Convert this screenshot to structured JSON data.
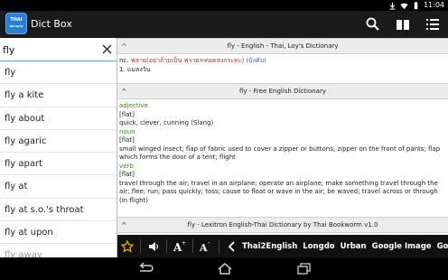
{
  "status_bar": {
    "time": "11:04",
    "icons": [
      "download-icon",
      "wifi-icon",
      "battery-icon"
    ]
  },
  "action_bar": {
    "app_icon_text_1": "THAI",
    "app_icon_text_2": "พจนานุกรม",
    "title": "Dict Box",
    "actions": [
      "search-icon",
      "book-icon",
      "menu-list-icon"
    ]
  },
  "search": {
    "value": "fly"
  },
  "word_list": [
    "fly",
    "fly a kite",
    "fly about",
    "fly agaric",
    "fly apart",
    "fly at",
    "fly at s.o.'s throat",
    "fly at upon",
    "fly away"
  ],
  "dictionaries": [
    {
      "title": "fly - English - Thai, Loy's Dictionary",
      "line1_prefix": "nc. ",
      "line1_red": "ฟลาย(อย่าถ้ามเป็น ฟราย=ทอดลงกระทะ)",
      "line1_blue": " (บังคับ)",
      "line2": "1. แมลงวัน"
    },
    {
      "title": "fly - Free English Dictionary",
      "entries": [
        {
          "pos": "adjective",
          "tag": "[flat]",
          "text": "quick, clever, cunning (Slang)"
        },
        {
          "pos": "noun",
          "tag": "[flat]",
          "text": "small winged insect; flap of fabric used to cover a zipper or buttons; zipper on the front of pants; flap which forms the door of a tent; flight"
        },
        {
          "pos": "verb",
          "tag": "[flat]",
          "text": "travel through the air; travel in an airplane; operate an airplane; make something travel through the air; flee; run; pass quickly; toss; cause to float or wave in the air; be waved; travel across or through (in flight)"
        }
      ]
    },
    {
      "title": "fly - Lexitron English-Thai Dictionary by Thai Bookworm v1.0"
    }
  ],
  "bottom_toolbar": {
    "icons": [
      "star-icon",
      "speaker-icon",
      "font-increase-icon",
      "font-decrease-icon",
      "chevron-left-icon"
    ],
    "links": [
      "Thai2English",
      "Longdo",
      "Urban",
      "Google Image",
      "Google Tra"
    ]
  },
  "nav_bar": [
    "back-icon",
    "home-icon",
    "recent-apps-icon"
  ],
  "colors": {
    "accent_blue": "#4aa3df",
    "pos_green": "#3a8c1f",
    "star_yellow": "#e8b400",
    "thai_red": "#c62828",
    "thai_blue": "#3b5bd6"
  }
}
